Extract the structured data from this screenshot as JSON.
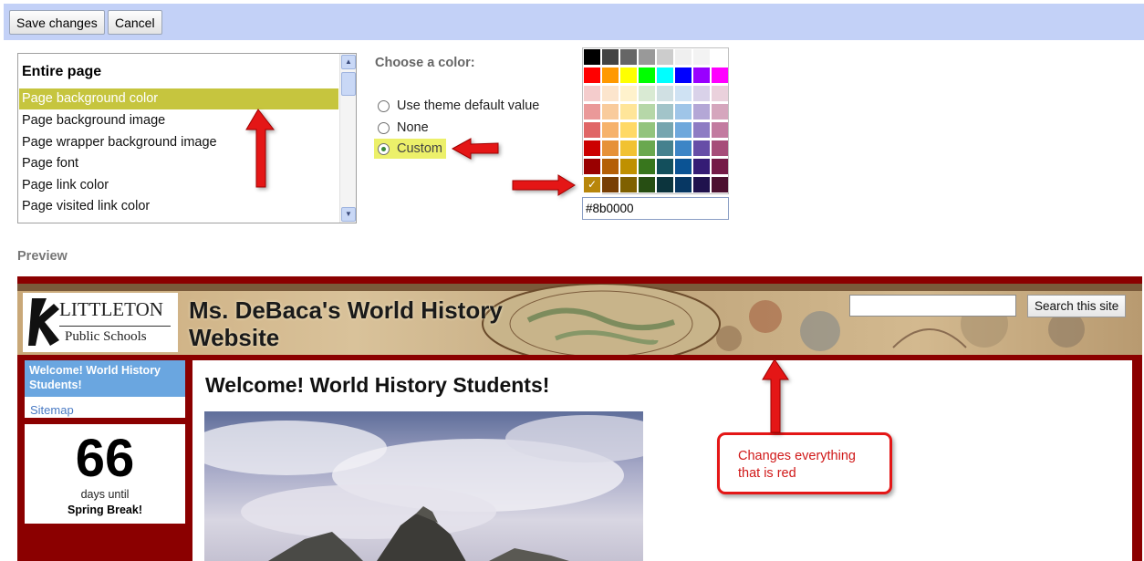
{
  "toolbar": {
    "save_label": "Save changes",
    "cancel_label": "Cancel"
  },
  "style_list": {
    "header": "Entire page",
    "items": [
      {
        "label": "Page background color",
        "selected": true
      },
      {
        "label": "Page background image",
        "selected": false
      },
      {
        "label": "Page wrapper background image",
        "selected": false
      },
      {
        "label": "Page font",
        "selected": false
      },
      {
        "label": "Page link color",
        "selected": false
      },
      {
        "label": "Page visited link color",
        "selected": false
      }
    ]
  },
  "color_chooser": {
    "label": "Choose a color:",
    "options": [
      {
        "label": "Use theme default value",
        "checked": false
      },
      {
        "label": "None",
        "checked": false
      },
      {
        "label": "Custom",
        "checked": true
      }
    ],
    "palette_rows": [
      [
        "#000000",
        "#434343",
        "#666666",
        "#999999",
        "#cccccc",
        "#efefef",
        "#f3f3f3",
        "#ffffff"
      ],
      [
        "#ff0000",
        "#ff9900",
        "#ffff00",
        "#00ff00",
        "#00ffff",
        "#0000ff",
        "#9900ff",
        "#ff00ff"
      ],
      [
        "#f4cccc",
        "#fce5cd",
        "#fff2cc",
        "#d9ead3",
        "#d0e0e3",
        "#cfe2f3",
        "#d9d2e9",
        "#ead1dc"
      ],
      [
        "#ea9999",
        "#f9cb9c",
        "#ffe599",
        "#b6d7a8",
        "#a2c4c9",
        "#9fc5e8",
        "#b4a7d6",
        "#d5a6bd"
      ],
      [
        "#e06666",
        "#f6b26b",
        "#ffd966",
        "#93c47d",
        "#76a5af",
        "#6fa8dc",
        "#8e7cc3",
        "#c27ba0"
      ],
      [
        "#cc0000",
        "#e69138",
        "#f1c232",
        "#6aa84f",
        "#45818e",
        "#3d85c6",
        "#674ea7",
        "#a64d79"
      ],
      [
        "#990000",
        "#b45f06",
        "#bf9000",
        "#38761d",
        "#134f5c",
        "#0b5394",
        "#351c75",
        "#741b47"
      ],
      [
        "#b8860b",
        "#783f04",
        "#7f6000",
        "#274e13",
        "#0c343d",
        "#073763",
        "#20124d",
        "#4c1130"
      ]
    ],
    "selected_mark": "✓",
    "hex_value": "#8b0000"
  },
  "preview": {
    "label": "Preview",
    "logo_line1": "LITTLETON",
    "logo_line2": "Public Schools",
    "site_title": "Ms. DeBaca's World History Website",
    "search_button": "Search this site",
    "nav_active": "Welcome! World History Students!",
    "nav_link": "Sitemap",
    "counter_number": "66",
    "counter_line1": "days until",
    "counter_line2": "Spring Break!",
    "content_title": "Welcome! World History Students!",
    "accent_color": "#8b0000"
  },
  "callout": {
    "text": "Changes everything that is red"
  }
}
